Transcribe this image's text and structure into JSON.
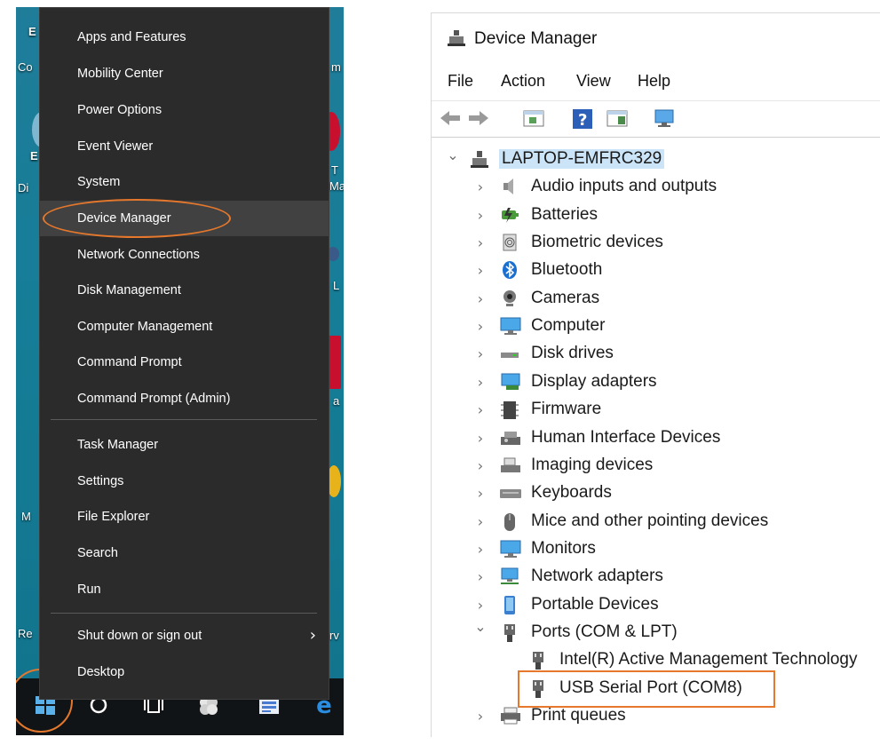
{
  "winx_menu": {
    "items": [
      {
        "label": "Apps and Features"
      },
      {
        "label": "Mobility Center"
      },
      {
        "label": "Power Options"
      },
      {
        "label": "Event Viewer"
      },
      {
        "label": "System"
      },
      {
        "label": "Device Manager",
        "highlighted": true
      },
      {
        "label": "Network Connections"
      },
      {
        "label": "Disk Management"
      },
      {
        "label": "Computer Management"
      },
      {
        "label": "Command Prompt"
      },
      {
        "label": "Command Prompt (Admin)"
      },
      {
        "label": "Task Manager"
      },
      {
        "label": "Settings"
      },
      {
        "label": "File Explorer"
      },
      {
        "label": "Search"
      },
      {
        "label": "Run"
      },
      {
        "label": "Shut down or sign out",
        "has_submenu": true
      },
      {
        "label": "Desktop"
      }
    ],
    "highlight_color": "#e5782c"
  },
  "desktop": {
    "fragments": [
      "Co",
      "Di",
      "M",
      "Re",
      "E",
      "T",
      "Ma",
      "L",
      "a",
      "rv",
      "m"
    ]
  },
  "taskbar": {
    "icons": [
      "windows-start-icon",
      "cortana-icon",
      "task-view-icon",
      "app-icon",
      "folder-icon",
      "edge-icon"
    ]
  },
  "device_manager": {
    "title": "Device Manager",
    "menu": {
      "file": "File",
      "action": "Action",
      "view": "View",
      "help": "Help"
    },
    "toolbar": [
      "back-icon",
      "forward-icon",
      "properties-icon",
      "help-icon",
      "action-pane-icon",
      "monitor-scan-icon"
    ],
    "root": "LAPTOP-EMFRC329",
    "categories": [
      {
        "label": "Audio inputs and outputs",
        "icon": "speaker-icon"
      },
      {
        "label": "Batteries",
        "icon": "battery-icon"
      },
      {
        "label": "Biometric devices",
        "icon": "fingerprint-icon"
      },
      {
        "label": "Bluetooth",
        "icon": "bluetooth-icon"
      },
      {
        "label": "Cameras",
        "icon": "camera-icon"
      },
      {
        "label": "Computer",
        "icon": "computer-icon"
      },
      {
        "label": "Disk drives",
        "icon": "disk-icon"
      },
      {
        "label": "Display adapters",
        "icon": "display-adapter-icon"
      },
      {
        "label": "Firmware",
        "icon": "firmware-icon"
      },
      {
        "label": "Human Interface Devices",
        "icon": "hid-icon"
      },
      {
        "label": "Imaging devices",
        "icon": "imaging-icon"
      },
      {
        "label": "Keyboards",
        "icon": "keyboard-icon"
      },
      {
        "label": "Mice and other pointing devices",
        "icon": "mouse-icon"
      },
      {
        "label": "Monitors",
        "icon": "monitor-icon"
      },
      {
        "label": "Network adapters",
        "icon": "network-icon"
      },
      {
        "label": "Portable Devices",
        "icon": "portable-device-icon"
      },
      {
        "label": "Ports (COM & LPT)",
        "icon": "port-icon",
        "expanded": true,
        "children": [
          {
            "label": "Intel(R) Active Management Technology"
          },
          {
            "label": "USB Serial Port (COM8)",
            "highlighted": true
          }
        ]
      },
      {
        "label": "Print queues",
        "icon": "printer-icon"
      }
    ]
  }
}
